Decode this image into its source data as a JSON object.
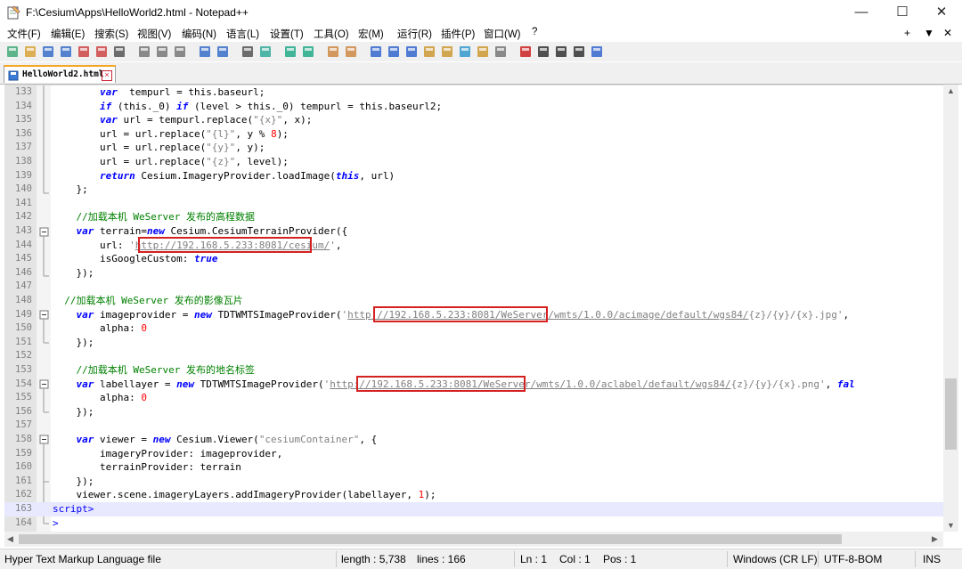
{
  "window": {
    "title": "F:\\Cesium\\Apps\\HelloWorld2.html - Notepad++",
    "minimize": "—",
    "maximize": "☐",
    "close": "✕"
  },
  "menu": {
    "items": [
      "文件(F)",
      "编辑(E)",
      "搜索(S)",
      "视图(V)",
      "编码(N)",
      "语言(L)",
      "设置(T)",
      "工具(O)",
      "宏(M)",
      "运行(R)",
      "插件(P)",
      "窗口(W)",
      "?"
    ],
    "right": [
      "+",
      "▼",
      "✕"
    ]
  },
  "toolbar": {
    "icons": [
      "new-icon",
      "open-icon",
      "save-icon",
      "save-all-icon",
      "close-icon",
      "close-all-icon",
      "print-icon",
      "cut-icon",
      "copy-icon",
      "paste-icon",
      "undo-icon",
      "redo-icon",
      "find-icon",
      "replace-icon",
      "zoom-in-icon",
      "zoom-out-icon",
      "sync-v-icon",
      "sync-h-icon",
      "wrap-icon",
      "all-chars-icon",
      "indent-guide-icon",
      "udl-icon",
      "doc-map-icon",
      "function-list-icon",
      "folder-workspace-icon",
      "monitor-icon",
      "record-macro-icon",
      "stop-macro-icon",
      "play-macro-icon",
      "run-macro-multiple-icon",
      "save-macro-icon"
    ]
  },
  "tab": {
    "label": "HelloWorld2.html"
  },
  "editor": {
    "lines": [
      {
        "n": "133",
        "segs": [
          [
            "t-kw",
            "        var"
          ],
          [
            "",
            "  tempurl = this.baseurl;"
          ]
        ]
      },
      {
        "n": "134",
        "segs": [
          [
            "t-kw",
            "        if"
          ],
          [
            "",
            " (this._0) "
          ],
          [
            "t-kw",
            "if"
          ],
          [
            "",
            " (level > this._0) tempurl = this.baseurl2;"
          ]
        ]
      },
      {
        "n": "135",
        "segs": [
          [
            "t-kw",
            "        var"
          ],
          [
            "",
            " url = tempurl.replace("
          ],
          [
            "t-str",
            "\"{x}\""
          ],
          [
            "",
            ", x);"
          ]
        ]
      },
      {
        "n": "136",
        "segs": [
          [
            "",
            "        url = url.replace("
          ],
          [
            "t-str",
            "\"{l}\""
          ],
          [
            "",
            ", y % "
          ],
          [
            "t-num",
            "8"
          ],
          [
            "",
            ");"
          ]
        ]
      },
      {
        "n": "137",
        "segs": [
          [
            "",
            "        url = url.replace("
          ],
          [
            "t-str",
            "\"{y}\""
          ],
          [
            "",
            ", y);"
          ]
        ]
      },
      {
        "n": "138",
        "segs": [
          [
            "",
            "        url = url.replace("
          ],
          [
            "t-str",
            "\"{z}\""
          ],
          [
            "",
            ", level);"
          ]
        ]
      },
      {
        "n": "139",
        "segs": [
          [
            "t-kw",
            "        return"
          ],
          [
            "",
            " Cesium.ImageryProvider.loadImage("
          ],
          [
            "t-kw",
            "this"
          ],
          [
            "",
            ", url)"
          ]
        ]
      },
      {
        "n": "140",
        "segs": [
          [
            "",
            "    };"
          ]
        ]
      },
      {
        "n": "141",
        "segs": [
          [
            "",
            ""
          ]
        ]
      },
      {
        "n": "142",
        "segs": [
          [
            "t-cmt",
            "    //加载本机 WeServer 发布的高程数据"
          ]
        ]
      },
      {
        "n": "143",
        "segs": [
          [
            "t-kw",
            "    var"
          ],
          [
            "",
            " terrain="
          ],
          [
            "t-kw",
            "new"
          ],
          [
            "",
            " Cesium.CesiumTerrainProvider({"
          ]
        ]
      },
      {
        "n": "144",
        "segs": [
          [
            "",
            "        url: "
          ],
          [
            "t-str",
            "'"
          ],
          [
            "t-url",
            "http://192.168.5.233:8081/cesium/"
          ],
          [
            "t-str",
            "'"
          ],
          [
            "",
            ","
          ]
        ]
      },
      {
        "n": "145",
        "segs": [
          [
            "",
            "        isGoogleCustom: "
          ],
          [
            "t-kw",
            "true"
          ]
        ]
      },
      {
        "n": "146",
        "segs": [
          [
            "",
            "    });"
          ]
        ]
      },
      {
        "n": "147",
        "segs": [
          [
            "",
            ""
          ]
        ]
      },
      {
        "n": "148",
        "segs": [
          [
            "t-cmt",
            "  //加载本机 WeServer 发布的影像瓦片"
          ]
        ]
      },
      {
        "n": "149",
        "segs": [
          [
            "t-kw",
            "    var"
          ],
          [
            "",
            " imageprovider = "
          ],
          [
            "t-kw",
            "new"
          ],
          [
            "",
            " TDTWMTSImageProvider("
          ],
          [
            "t-str",
            "'"
          ],
          [
            "t-url",
            "http://192.168.5.233:8081/WeServer/wmts/1.0.0/acimage/default/wgs84/"
          ],
          [
            "t-str",
            "{z}/{y}/{x}.jpg'"
          ],
          [
            "",
            ","
          ]
        ]
      },
      {
        "n": "150",
        "segs": [
          [
            "",
            "        alpha: "
          ],
          [
            "t-num",
            "0"
          ]
        ]
      },
      {
        "n": "151",
        "segs": [
          [
            "",
            "    });"
          ]
        ]
      },
      {
        "n": "152",
        "segs": [
          [
            "",
            ""
          ]
        ]
      },
      {
        "n": "153",
        "segs": [
          [
            "t-cmt",
            "    //加载本机 WeServer 发布的地名标签"
          ]
        ]
      },
      {
        "n": "154",
        "segs": [
          [
            "t-kw",
            "    var"
          ],
          [
            "",
            " labellayer = "
          ],
          [
            "t-kw",
            "new"
          ],
          [
            "",
            " TDTWMTSImageProvider("
          ],
          [
            "t-str",
            "'"
          ],
          [
            "t-url",
            "http://192.168.5.233:8081/WeServer/wmts/1.0.0/aclabel/default/wgs84/"
          ],
          [
            "t-str",
            "{z}/{y}/{x}.png'"
          ],
          [
            "",
            ", "
          ],
          [
            "t-kw",
            "fal"
          ]
        ]
      },
      {
        "n": "155",
        "segs": [
          [
            "",
            "        alpha: "
          ],
          [
            "t-num",
            "0"
          ]
        ]
      },
      {
        "n": "156",
        "segs": [
          [
            "",
            "    });"
          ]
        ]
      },
      {
        "n": "157",
        "segs": [
          [
            "",
            ""
          ]
        ]
      },
      {
        "n": "158",
        "segs": [
          [
            "t-kw",
            "    var"
          ],
          [
            "",
            " viewer = "
          ],
          [
            "t-kw",
            "new"
          ],
          [
            "",
            " Cesium.Viewer("
          ],
          [
            "t-str",
            "\"cesiumContainer\""
          ],
          [
            "",
            ", {"
          ]
        ]
      },
      {
        "n": "159",
        "segs": [
          [
            "",
            "        imageryProvider: imageprovider,"
          ]
        ]
      },
      {
        "n": "160",
        "segs": [
          [
            "",
            "        terrainProvider: terrain"
          ]
        ]
      },
      {
        "n": "161",
        "segs": [
          [
            "",
            "    });"
          ]
        ]
      },
      {
        "n": "162",
        "segs": [
          [
            "",
            "    viewer.scene.imageryLayers.addImageryProvider(labellayer, "
          ],
          [
            "t-num",
            "1"
          ],
          [
            "",
            ");"
          ]
        ]
      },
      {
        "n": "163",
        "segs": [
          [
            "t-tag",
            "script>"
          ]
        ]
      },
      {
        "n": "164",
        "segs": [
          [
            "t-tag",
            ">"
          ]
        ]
      }
    ]
  },
  "status": {
    "file_type": "Hyper Text Markup Language file",
    "length": "length : 5,738",
    "lines": "lines : 166",
    "ln": "Ln : 1",
    "col": "Col : 1",
    "pos": "Pos : 1",
    "eol": "Windows (CR LF)",
    "encoding": "UTF-8-BOM",
    "mode": "INS"
  }
}
